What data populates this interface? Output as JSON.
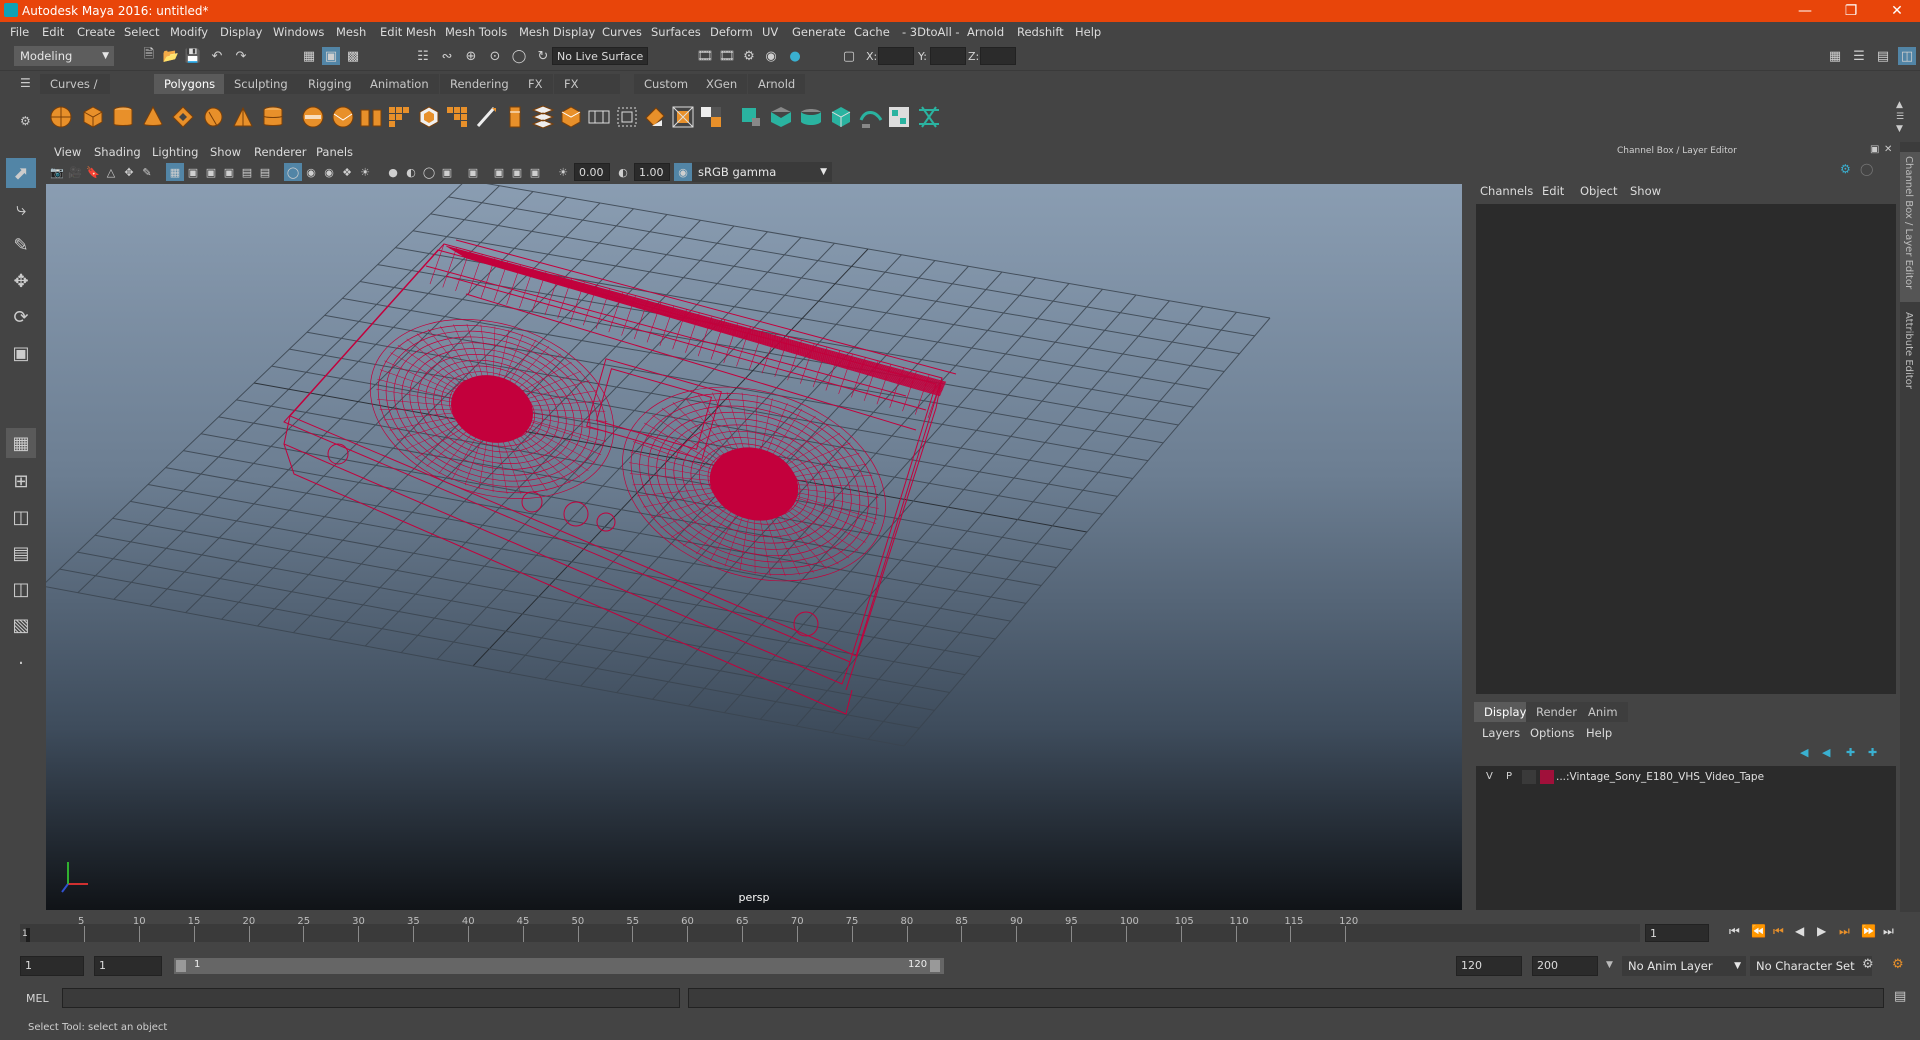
{
  "window": {
    "title": "Autodesk Maya 2016: untitled*"
  },
  "menubar": {
    "items": [
      "File",
      "Edit",
      "Create",
      "Select",
      "Modify",
      "Display",
      "Windows",
      "Mesh",
      "Edit Mesh",
      "Mesh Tools",
      "Mesh Display",
      "Curves",
      "Surfaces",
      "Deform",
      "UV",
      "Generate",
      "Cache",
      "- 3DtoAll -",
      "Arnold",
      "Redshift",
      "Help"
    ]
  },
  "statusline": {
    "mode": "Modeling",
    "live_surface": "No Live Surface",
    "x_label": "X:",
    "y_label": "Y:",
    "z_label": "Z:"
  },
  "shelf": {
    "tabs": [
      "Curves / Surfaces",
      "Polygons",
      "Sculpting",
      "Rigging",
      "Animation",
      "Rendering",
      "FX",
      "FX Caching",
      "Custom",
      "XGen",
      "Arnold"
    ],
    "active_tab": "Polygons",
    "orange": "#e8902a",
    "teal": "#2ab3a0"
  },
  "viewport": {
    "menu": [
      "View",
      "Shading",
      "Lighting",
      "Show",
      "Renderer",
      "Panels"
    ],
    "exposure": "0.00",
    "gamma": "1.00",
    "color_space": "sRGB gamma",
    "camera": "persp",
    "wire_color": "#c3003c"
  },
  "channelbox": {
    "title": "Channel Box / Layer Editor",
    "menu": [
      "Channels",
      "Edit",
      "Object",
      "Show"
    ]
  },
  "layers": {
    "tabs": [
      "Display",
      "Render",
      "Anim"
    ],
    "active_tab": "Display",
    "menu": [
      "Layers",
      "Options",
      "Help"
    ],
    "rows": [
      {
        "v": "V",
        "p": "P",
        "color": "#a0103a",
        "name": "...:Vintage_Sony_E180_VHS_Video_Tape"
      }
    ]
  },
  "side_tabs": [
    "Channel Box / Layer Editor",
    "Attribute Editor"
  ],
  "timeline": {
    "ticks": [
      "5",
      "10",
      "15",
      "20",
      "25",
      "30",
      "35",
      "40",
      "45",
      "50",
      "55",
      "60",
      "65",
      "70",
      "75",
      "80",
      "85",
      "90",
      "95",
      "100",
      "105",
      "110",
      "115",
      "120"
    ],
    "current_marker": "1",
    "current_frame": "1"
  },
  "range": {
    "start": "1",
    "playback_start": "1",
    "slider_start": "1",
    "slider_end": "120",
    "playback_end": "120",
    "end": "200",
    "anim_layer": "No Anim Layer",
    "character_set": "No Character Set"
  },
  "mel": {
    "label": "MEL"
  },
  "help": {
    "text": "Select Tool: select an object"
  }
}
